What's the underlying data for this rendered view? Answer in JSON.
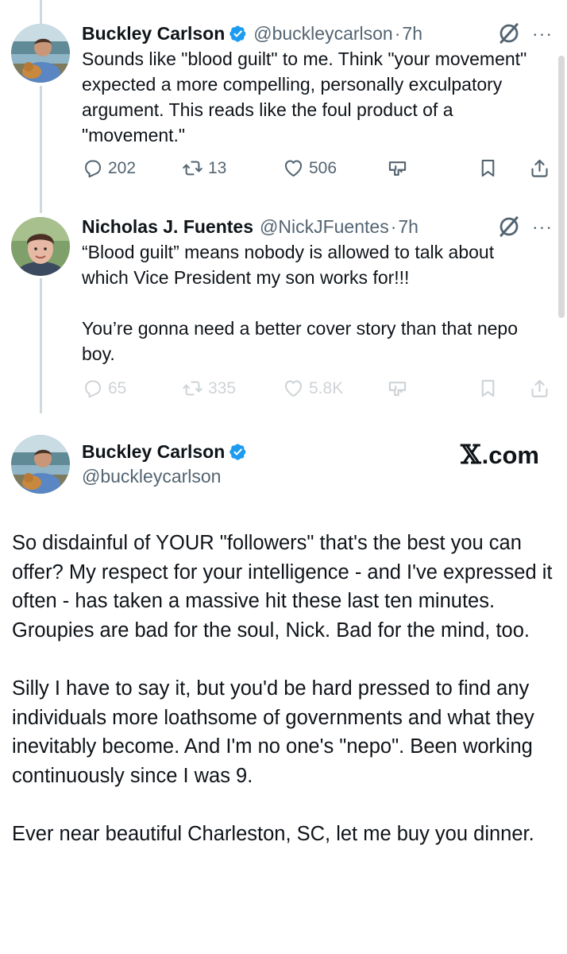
{
  "tweets": [
    {
      "name": "Buckley Carlson",
      "handle": "@buckleycarlson",
      "separator": "·",
      "time": "7h",
      "text": "Sounds like \"blood guilt\" to me. Think \"your movement\" expected a more compelling, personally exculpatory argument. This reads like the foul product of a \"movement.\"",
      "replies": "202",
      "reposts": "13",
      "likes": "506",
      "more": "···"
    },
    {
      "name": "Nicholas J. Fuentes",
      "handle": "@NickJFuentes",
      "separator": "·",
      "time": "7h",
      "text": "“Blood guilt” means nobody is allowed to talk about which Vice President my son works for!!!\n\nYou’re gonna need a better cover story than that nepo boy.",
      "replies": "65",
      "reposts": "335",
      "likes": "5.8K",
      "more": "···"
    }
  ],
  "card": {
    "name": "Buckley Carlson",
    "handle": "@buckleycarlson",
    "logo_text": ".com",
    "logo_mark": "𝕏",
    "text": "So disdainful of YOUR \"followers\" that's the best you can offer? My respect for your intelligence - and I've expressed it often - has taken a massive hit these last ten minutes. Groupies are bad for the soul, Nick. Bad for the mind, too.\n\nSilly I have to say it, but you'd be hard pressed to find any individuals more loathsome of governments and what they inevitably become. And I'm no one's \"nepo\". Been working continuously since I was 9.\n\nEver near beautiful Charleston, SC, let me buy you dinner."
  },
  "icons": {
    "verified": "verified-badge-icon",
    "grok": "grok-icon",
    "reply": "reply-icon",
    "repost": "repost-icon",
    "like": "heart-icon",
    "views": "grok-analyze-icon",
    "bookmark": "bookmark-icon",
    "share": "share-icon"
  },
  "colors": {
    "verified": "#1d9bf0",
    "text": "#0f1419",
    "secondary": "#536471",
    "thread_line": "#cfd9de"
  }
}
